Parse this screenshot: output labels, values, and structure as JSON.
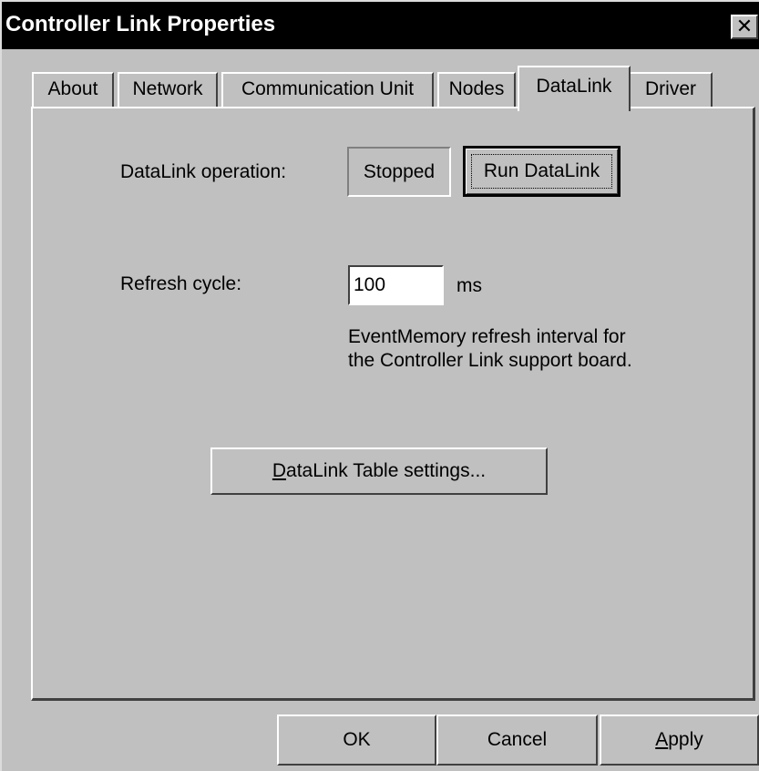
{
  "window": {
    "title": "Controller Link Properties",
    "close_glyph": "✕"
  },
  "tabs": [
    {
      "label": "About",
      "active": false
    },
    {
      "label": "Network",
      "active": false
    },
    {
      "label": "Communication Unit",
      "active": false
    },
    {
      "label": "Nodes",
      "active": false
    },
    {
      "label": "DataLink",
      "active": true
    },
    {
      "label": "Driver",
      "active": false
    }
  ],
  "datalink": {
    "operation_label": "DataLink operation:",
    "status_value": "Stopped",
    "run_button_label": "Run DataLink",
    "refresh_label": "Refresh cycle:",
    "refresh_value": "100",
    "refresh_unit": "ms",
    "description_line1": "EventMemory refresh interval for",
    "description_line2": "the Controller Link support board.",
    "table_button_label_mnemonic": "D",
    "table_button_label_rest": "ataLink Table settings..."
  },
  "footer": {
    "ok_label": "OK",
    "cancel_label": "Cancel",
    "apply_mnemonic": "A",
    "apply_rest": "pply"
  },
  "colors": {
    "face": "#c0c0c0",
    "titlebar": "#000000",
    "highlight": "#ffffff",
    "shadow": "#404040"
  }
}
